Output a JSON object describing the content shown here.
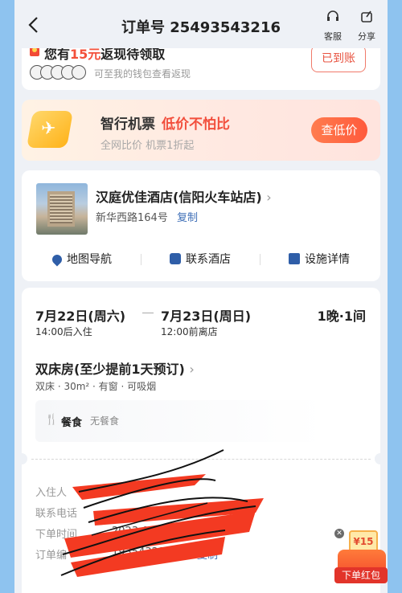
{
  "header": {
    "title": "订单号 25493543216",
    "back_icon": "chevron-left-icon",
    "service_label": "客服",
    "share_label": "分享"
  },
  "cashback": {
    "prefix": "您有",
    "amount": "15元",
    "suffix": "返现待领取",
    "subtitle": "可至我的钱包查看返现",
    "button": "已到账"
  },
  "flight_promo": {
    "title": "智行机票",
    "highlight": "低价不怕比",
    "subtitle": "全网比价 机票1折起",
    "button": "查低价"
  },
  "hotel": {
    "name": "汉庭优佳酒店(信阳火车站店)",
    "address": "新华西路164号",
    "copy_label": "复制",
    "actions": [
      {
        "label": "地图导航",
        "icon": "map-pin-icon"
      },
      {
        "label": "联系酒店",
        "icon": "phone-icon"
      },
      {
        "label": "设施详情",
        "icon": "facility-icon"
      }
    ]
  },
  "booking": {
    "checkin_date": "7月22日(周六)",
    "checkin_note": "14:00后入住",
    "checkout_date": "7月23日(周日)",
    "checkout_note": "12:00前离店",
    "nights_rooms": "1晚·1间",
    "room_name": "双床房(至少提前1天预订)",
    "room_features": "双床 · 30m² · 有窗 · 可吸烟",
    "meal_label": "餐食",
    "meal_value": "无餐食"
  },
  "details": {
    "guest_label": "入住人",
    "phone_label": "联系电话",
    "order_time_label": "下单时间",
    "order_time_value": "2023-0  -  12",
    "order_no_label": "订单编",
    "order_no_value": "193543216",
    "copy_label": "复制"
  },
  "floating": {
    "coupon": "¥15",
    "label": "下单红包"
  },
  "colors": {
    "accent_red": "#f24e3c",
    "link_blue": "#3f6fb7",
    "frame_blue": "#8ec3ef"
  }
}
